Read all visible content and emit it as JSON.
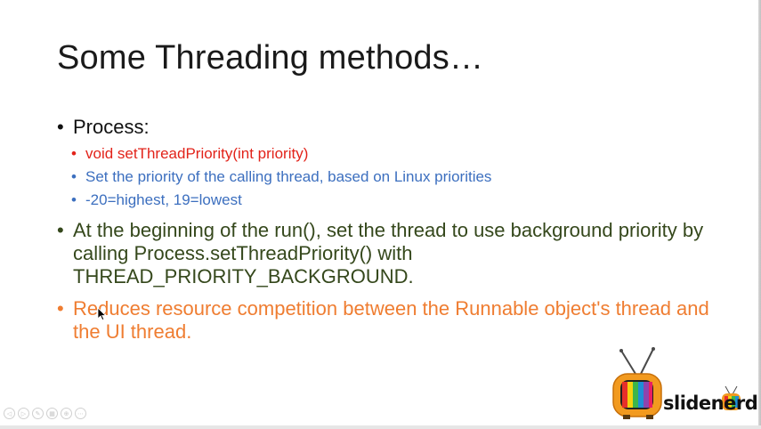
{
  "slide": {
    "title": "Some Threading methods…",
    "bullets": [
      {
        "marker": "•",
        "text": "Process:",
        "color": "#111111",
        "sub": [
          {
            "marker": "•",
            "text": "void setThreadPriority(int priority)",
            "color": "#e2231a"
          },
          {
            "marker": "•",
            "text": "Set the priority of the calling thread, based on Linux priorities",
            "color": "#3c6fbf"
          },
          {
            "marker": "•",
            "text": "-20=highest, 19=lowest",
            "color": "#3c6fbf"
          }
        ]
      },
      {
        "marker": "•",
        "text": "At the beginning of the run(), set the thread to use background priority by calling Process.setThreadPriority() with THREAD_PRIORITY_BACKGROUND.",
        "color": "#35481c"
      },
      {
        "marker": "•",
        "text": "Reduces resource competition between the Runnable object's thread and the UI thread.",
        "color": "#ef7d31"
      }
    ]
  },
  "logo": {
    "text": "slidenerd",
    "icon": "retro-tv-icon"
  },
  "controls": [
    {
      "icon": "previous-slide-icon",
      "glyph": "◁"
    },
    {
      "icon": "next-slide-icon",
      "glyph": "▷"
    },
    {
      "icon": "pen-icon",
      "glyph": "✎"
    },
    {
      "icon": "slides-grid-icon",
      "glyph": "▦"
    },
    {
      "icon": "zoom-icon",
      "glyph": "⊕"
    },
    {
      "icon": "more-options-icon",
      "glyph": "⋯"
    }
  ]
}
